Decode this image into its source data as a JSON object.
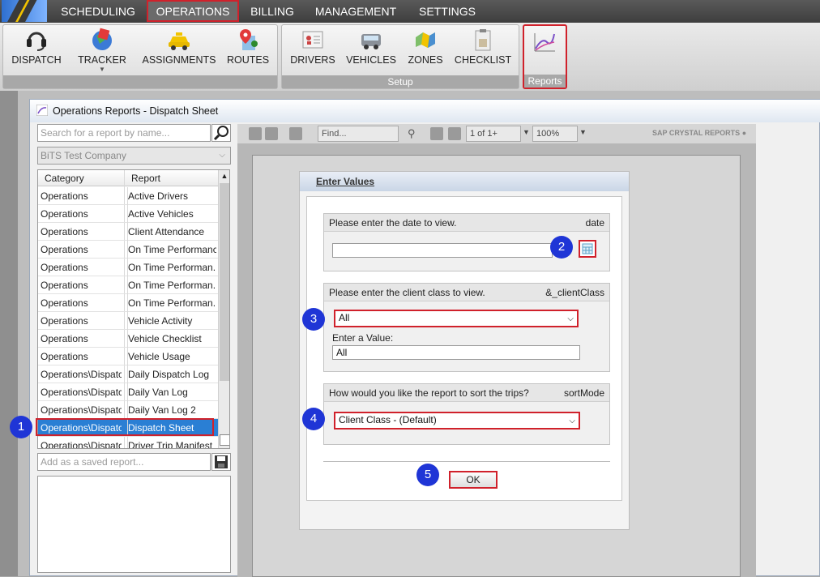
{
  "menu": {
    "items": [
      "SCHEDULING",
      "OPERATIONS",
      "BILLING",
      "MANAGEMENT",
      "SETTINGS"
    ],
    "active": "OPERATIONS"
  },
  "ribbon": {
    "main_buttons": [
      "DISPATCH",
      "TRACKER",
      "ASSIGNMENTS",
      "ROUTES"
    ],
    "setup_buttons": [
      "DRIVERS",
      "VEHICLES",
      "ZONES",
      "CHECKLIST"
    ],
    "setup_caption": "Setup",
    "reports_caption": "Reports"
  },
  "window": {
    "title": "Operations Reports - Dispatch Sheet"
  },
  "left_panel": {
    "search_placeholder": "Search for a report by name...",
    "company": "BiTS Test Company",
    "columns": [
      "Category",
      "Report"
    ],
    "rows": [
      {
        "category": "Operations",
        "report": "Active Drivers"
      },
      {
        "category": "Operations",
        "report": "Active Vehicles"
      },
      {
        "category": "Operations",
        "report": "Client Attendance"
      },
      {
        "category": "Operations",
        "report": "On Time Performance"
      },
      {
        "category": "Operations",
        "report": "On Time Performan..."
      },
      {
        "category": "Operations",
        "report": "On Time Performan..."
      },
      {
        "category": "Operations",
        "report": "On Time Performan..."
      },
      {
        "category": "Operations",
        "report": "Vehicle Activity"
      },
      {
        "category": "Operations",
        "report": "Vehicle Checklist"
      },
      {
        "category": "Operations",
        "report": "Vehicle Usage"
      },
      {
        "category": "Operations\\Dispatch",
        "report": "Daily Dispatch Log"
      },
      {
        "category": "Operations\\Dispatch",
        "report": "Daily Van Log"
      },
      {
        "category": "Operations\\Dispatch",
        "report": "Daily Van Log 2"
      },
      {
        "category": "Operations\\Dispatch",
        "report": "Dispatch Sheet"
      },
      {
        "category": "Operations\\Dispatch",
        "report": "Driver Trip Manifest"
      }
    ],
    "selected_index": 13,
    "saved_placeholder": "Add as a saved report..."
  },
  "report_toolbar": {
    "find_placeholder": "Find...",
    "page_info": "1 of 1+",
    "zoom": "100%",
    "brand": "SAP CRYSTAL REPORTS"
  },
  "dialog": {
    "title": "Enter Values",
    "params": [
      {
        "prompt": "Please enter the date to view.",
        "name": "date",
        "value": ""
      },
      {
        "prompt": "Please enter the client class to view.",
        "name": "&_clientClass",
        "selected": "All",
        "enter_label": "Enter a Value:",
        "value": "All"
      },
      {
        "prompt": "How would you like the report to sort the trips?",
        "name": "sortMode",
        "selected": "Client Class - (Default)"
      }
    ],
    "ok_label": "OK"
  },
  "badges": [
    "1",
    "2",
    "3",
    "4",
    "5"
  ],
  "colors": {
    "highlight": "#d0212b",
    "badge": "#1f35d6",
    "selection": "#2a7fd4"
  }
}
